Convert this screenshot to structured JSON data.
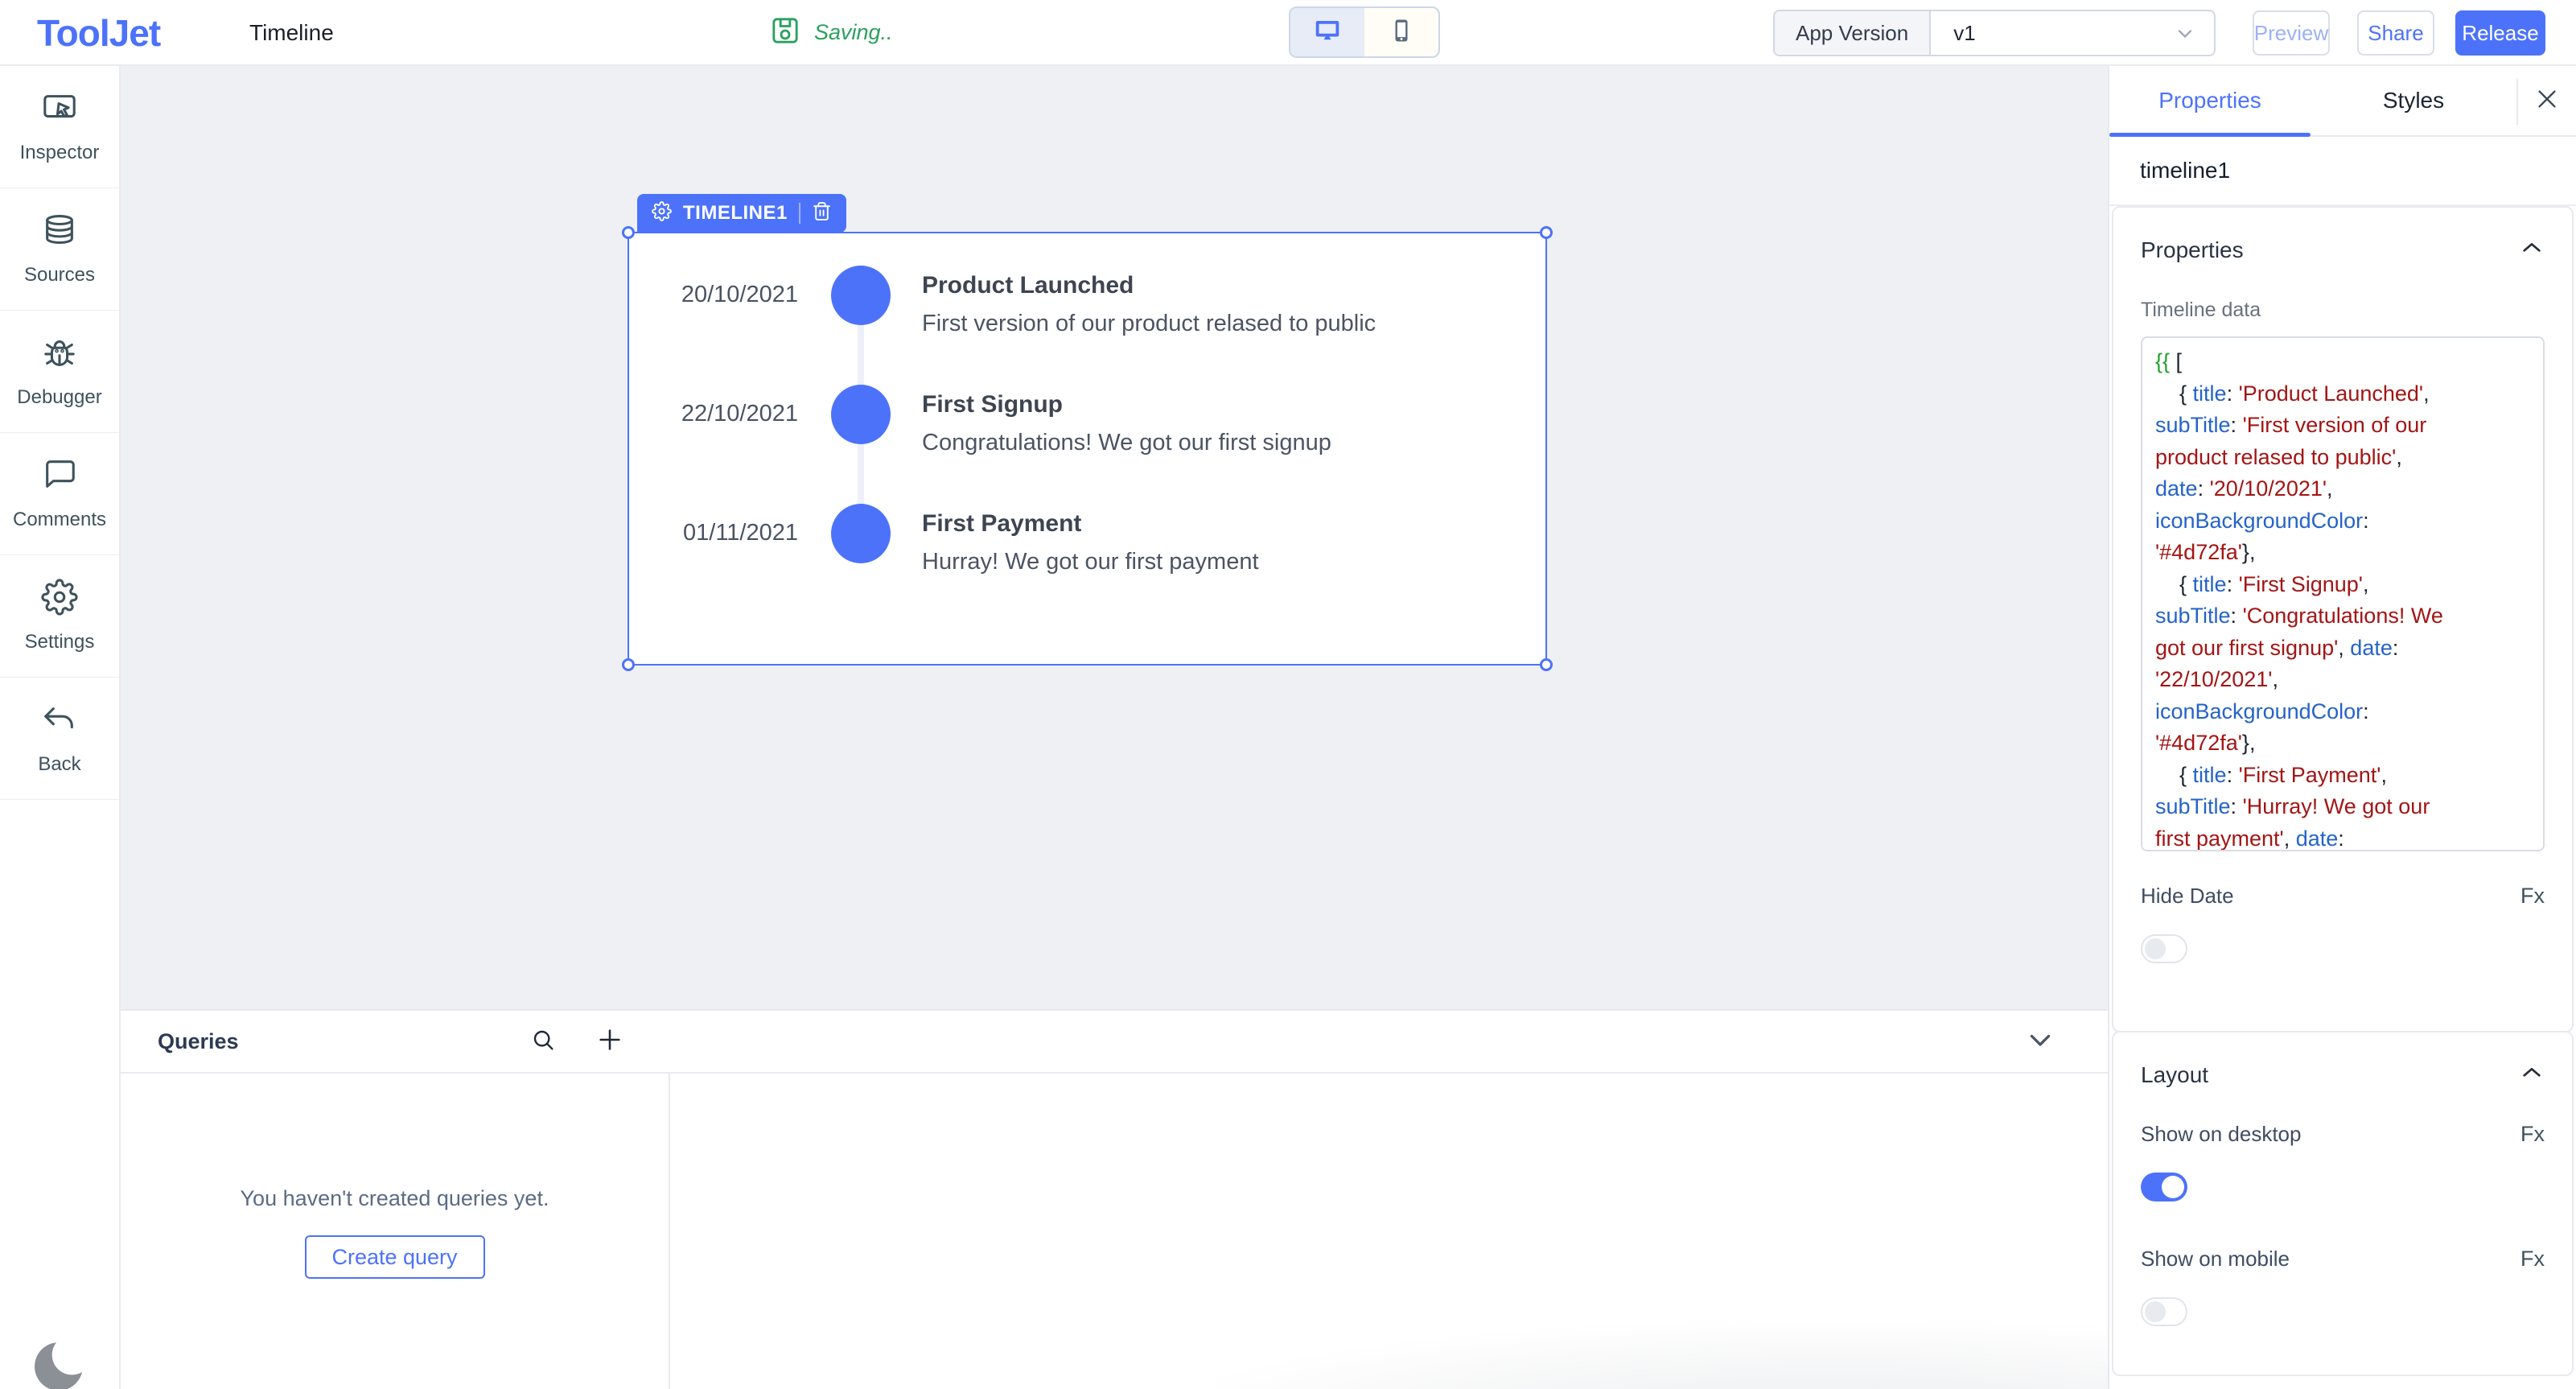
{
  "colors": {
    "accent": "#4d72fa",
    "saving_green": "#2ba05f",
    "canvas_bg": "#eef0f4",
    "code_key": "#2563c9",
    "code_string": "#a31515",
    "code_mustache": "#22a12c"
  },
  "topbar": {
    "logo": "ToolJet",
    "app_name": "Timeline",
    "saving_status": "Saving..",
    "app_version_label": "App Version",
    "app_version_value": "v1",
    "preview_label": "Preview",
    "share_label": "Share",
    "release_label": "Release"
  },
  "left_sidebar": {
    "items": [
      {
        "label": "Inspector"
      },
      {
        "label": "Sources"
      },
      {
        "label": "Debugger"
      },
      {
        "label": "Comments"
      },
      {
        "label": "Settings"
      },
      {
        "label": "Back"
      }
    ]
  },
  "canvas": {
    "widget_tag": {
      "name": "TIMELINE1"
    },
    "timeline_widget": {
      "entries": [
        {
          "date": "20/10/2021",
          "title": "Product Launched",
          "subtitle": "First version of our product relased to public",
          "icon_background_color": "#4d72fa"
        },
        {
          "date": "22/10/2021",
          "title": "First Signup",
          "subtitle": "Congratulations! We got our first signup",
          "icon_background_color": "#4d72fa"
        },
        {
          "date": "01/11/2021",
          "title": "First Payment",
          "subtitle": "Hurray! We got our first payment",
          "icon_background_color": "#4d72fa"
        }
      ]
    }
  },
  "query_panel": {
    "title": "Queries",
    "empty_message": "You haven't created queries yet.",
    "create_button_label": "Create query"
  },
  "properties_panel": {
    "tabs": [
      {
        "label": "Properties",
        "active": true
      },
      {
        "label": "Styles",
        "active": false
      }
    ],
    "widget_name": "timeline1",
    "sections": {
      "properties": {
        "title": "Properties",
        "timeline_data_label": "Timeline data",
        "hide_date_label": "Hide Date",
        "fx_label": "Fx",
        "hide_date_toggle": "off",
        "code_lines": [
          [
            {
              "t": "mustache",
              "s": "{{ "
            },
            {
              "t": "plain",
              "s": "["
            }
          ],
          [
            {
              "t": "plain",
              "s": "    { "
            },
            {
              "t": "key",
              "s": "title"
            },
            {
              "t": "plain",
              "s": ": "
            },
            {
              "t": "str",
              "s": "'Product Launched'"
            },
            {
              "t": "plain",
              "s": ","
            }
          ],
          [
            {
              "t": "key",
              "s": "subTitle"
            },
            {
              "t": "plain",
              "s": ": "
            },
            {
              "t": "str",
              "s": "'First version of our"
            }
          ],
          [
            {
              "t": "str",
              "s": "product relased to public'"
            },
            {
              "t": "plain",
              "s": ","
            }
          ],
          [
            {
              "t": "key",
              "s": "date"
            },
            {
              "t": "plain",
              "s": ": "
            },
            {
              "t": "str",
              "s": "'20/10/2021'"
            },
            {
              "t": "plain",
              "s": ","
            }
          ],
          [
            {
              "t": "key",
              "s": "iconBackgroundColor"
            },
            {
              "t": "plain",
              "s": ":"
            }
          ],
          [
            {
              "t": "str",
              "s": "'#4d72fa'"
            },
            {
              "t": "plain",
              "s": "},"
            }
          ],
          [
            {
              "t": "plain",
              "s": "    { "
            },
            {
              "t": "key",
              "s": "title"
            },
            {
              "t": "plain",
              "s": ": "
            },
            {
              "t": "str",
              "s": "'First Signup'"
            },
            {
              "t": "plain",
              "s": ","
            }
          ],
          [
            {
              "t": "key",
              "s": "subTitle"
            },
            {
              "t": "plain",
              "s": ": "
            },
            {
              "t": "str",
              "s": "'Congratulations! We"
            }
          ],
          [
            {
              "t": "str",
              "s": "got our first signup'"
            },
            {
              "t": "plain",
              "s": ", "
            },
            {
              "t": "key",
              "s": "date"
            },
            {
              "t": "plain",
              "s": ":"
            }
          ],
          [
            {
              "t": "str",
              "s": "'22/10/2021'"
            },
            {
              "t": "plain",
              "s": ","
            }
          ],
          [
            {
              "t": "key",
              "s": "iconBackgroundColor"
            },
            {
              "t": "plain",
              "s": ":"
            }
          ],
          [
            {
              "t": "str",
              "s": "'#4d72fa'"
            },
            {
              "t": "plain",
              "s": "},"
            }
          ],
          [
            {
              "t": "plain",
              "s": "    { "
            },
            {
              "t": "key",
              "s": "title"
            },
            {
              "t": "plain",
              "s": ": "
            },
            {
              "t": "str",
              "s": "'First Payment'"
            },
            {
              "t": "plain",
              "s": ","
            }
          ],
          [
            {
              "t": "key",
              "s": "subTitle"
            },
            {
              "t": "plain",
              "s": ": "
            },
            {
              "t": "str",
              "s": "'Hurray! We got our"
            }
          ],
          [
            {
              "t": "str",
              "s": "first payment'"
            },
            {
              "t": "plain",
              "s": ", "
            },
            {
              "t": "key",
              "s": "date"
            },
            {
              "t": "plain",
              "s": ":"
            }
          ]
        ]
      },
      "layout": {
        "title": "Layout",
        "show_on_desktop_label": "Show on desktop",
        "show_on_mobile_label": "Show on mobile",
        "fx_label": "Fx",
        "show_on_desktop_toggle": "on",
        "show_on_mobile_toggle": "off"
      }
    }
  }
}
